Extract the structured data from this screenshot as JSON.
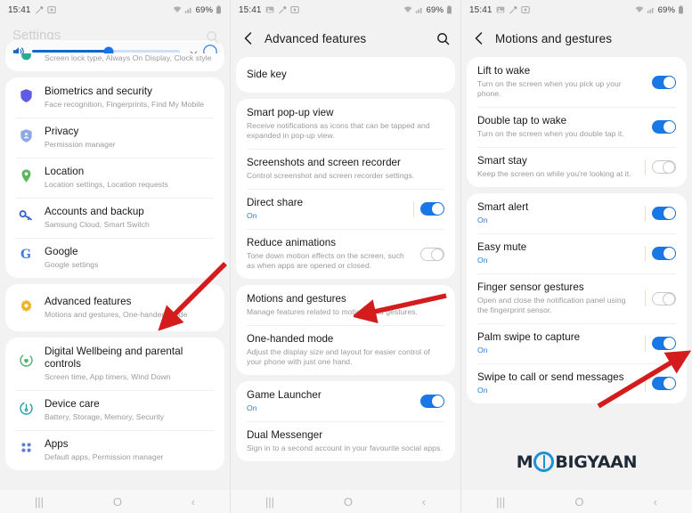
{
  "colors": {
    "accent_blue": "#1a78e6",
    "arrow_red": "#d51c1c",
    "card_bg": "#ffffff",
    "page_bg": "#f2f2f2",
    "sub_text": "#9a9a9a",
    "on_text": "#2a7fd4"
  },
  "status_bar": {
    "time": "15:41",
    "battery": "69%",
    "icons_left": [
      "image-icon",
      "tool-icon",
      "screenshot-icon"
    ],
    "icons_right": [
      "wifi-icon",
      "signal-icon",
      "battery-icon"
    ]
  },
  "nav_bar": {
    "recents": "|||",
    "home": "O",
    "back": "‹"
  },
  "watermark": {
    "part1": "M",
    "part2": "BIGYAAN"
  },
  "panel1": {
    "title": "Settings",
    "search_icon": "search-icon",
    "volume": {
      "icon": "volume-up-icon",
      "level_percent": 52,
      "chevron_icon": "chevron-down-icon",
      "moon_icon": "moon-icon"
    },
    "cards": [
      {
        "rows": [
          {
            "icon": "lockscreen-icon",
            "title": "",
            "sub": "Screen lock type, Always On Display, Clock style",
            "clipped": true
          }
        ]
      },
      {
        "rows": [
          {
            "icon": "shield-icon",
            "title": "Biometrics and security",
            "sub": "Face recognition, Fingerprints, Find My Mobile"
          },
          {
            "icon": "privacy-icon",
            "title": "Privacy",
            "sub": "Permission manager"
          },
          {
            "icon": "location-icon",
            "title": "Location",
            "sub": "Location settings, Location requests"
          },
          {
            "icon": "key-icon",
            "title": "Accounts and backup",
            "sub": "Samsung Cloud, Smart Switch"
          },
          {
            "icon": "google-icon",
            "title": "Google",
            "sub": "Google settings"
          }
        ]
      },
      {
        "rows": [
          {
            "icon": "gear-flower-icon",
            "title": "Advanced features",
            "sub": "Motions and gestures, One-handed mode"
          }
        ]
      },
      {
        "rows": [
          {
            "icon": "wellbeing-icon",
            "title": "Digital Wellbeing and parental controls",
            "sub": "Screen time, App timers, Wind Down"
          },
          {
            "icon": "device-care-icon",
            "title": "Device care",
            "sub": "Battery, Storage, Memory, Security"
          },
          {
            "icon": "apps-icon",
            "title": "Apps",
            "sub": "Default apps, Permission manager"
          }
        ]
      }
    ]
  },
  "panel2": {
    "title": "Advanced features",
    "back_icon": "back-chevron-icon",
    "search_icon": "search-icon",
    "cards": [
      {
        "rows": [
          {
            "title": "Side key",
            "sub": "",
            "single": true
          }
        ]
      },
      {
        "rows": [
          {
            "title": "Smart pop-up view",
            "sub": "Receive notifications as icons that can be tapped and expanded in pop-up view."
          },
          {
            "title": "Screenshots and screen recorder",
            "sub": "Control screenshot and screen recorder settings."
          },
          {
            "title": "Direct share",
            "sub": "On",
            "sub_on": true,
            "toggle": "on",
            "divider": true
          },
          {
            "title": "Reduce animations",
            "sub": "Tone down motion effects on the screen, such as when apps are opened or closed.",
            "toggle": "off"
          }
        ]
      },
      {
        "rows": [
          {
            "title": "Motions and gestures",
            "sub": "Manage features related to motions and gestures."
          },
          {
            "title": "One-handed mode",
            "sub": "Adjust the display size and layout for easier control of your phone with just one hand."
          }
        ]
      },
      {
        "rows": [
          {
            "title": "Game Launcher",
            "sub": "On",
            "sub_on": true,
            "toggle": "on"
          },
          {
            "title": "Dual Messenger",
            "sub": "Sign in to a second account in your favourite social apps."
          }
        ]
      }
    ]
  },
  "panel3": {
    "title": "Motions and gestures",
    "back_icon": "back-chevron-icon",
    "cards": [
      {
        "rows": [
          {
            "title": "Lift to wake",
            "sub": "Turn on the screen when you pick up your phone.",
            "toggle": "on"
          },
          {
            "title": "Double tap to wake",
            "sub": "Turn on the screen when you double tap it.",
            "toggle": "on"
          },
          {
            "title": "Smart stay",
            "sub": "Keep the screen on while you're looking at it.",
            "toggle": "off",
            "divider": true
          }
        ]
      },
      {
        "rows": [
          {
            "title": "Smart alert",
            "sub": "On",
            "sub_on": true,
            "toggle": "on",
            "divider": true
          },
          {
            "title": "Easy mute",
            "sub": "On",
            "sub_on": true,
            "toggle": "on",
            "divider": true
          },
          {
            "title": "Finger sensor gestures",
            "sub": "Open and close the notification panel using the fingerprint sensor.",
            "toggle": "off",
            "divider": true
          },
          {
            "title": "Palm swipe to capture",
            "sub": "On",
            "sub_on": true,
            "toggle": "on",
            "divider": true
          },
          {
            "title": "Swipe to call or send messages",
            "sub": "On",
            "sub_on": true,
            "toggle": "on",
            "divider": true
          }
        ]
      }
    ]
  }
}
